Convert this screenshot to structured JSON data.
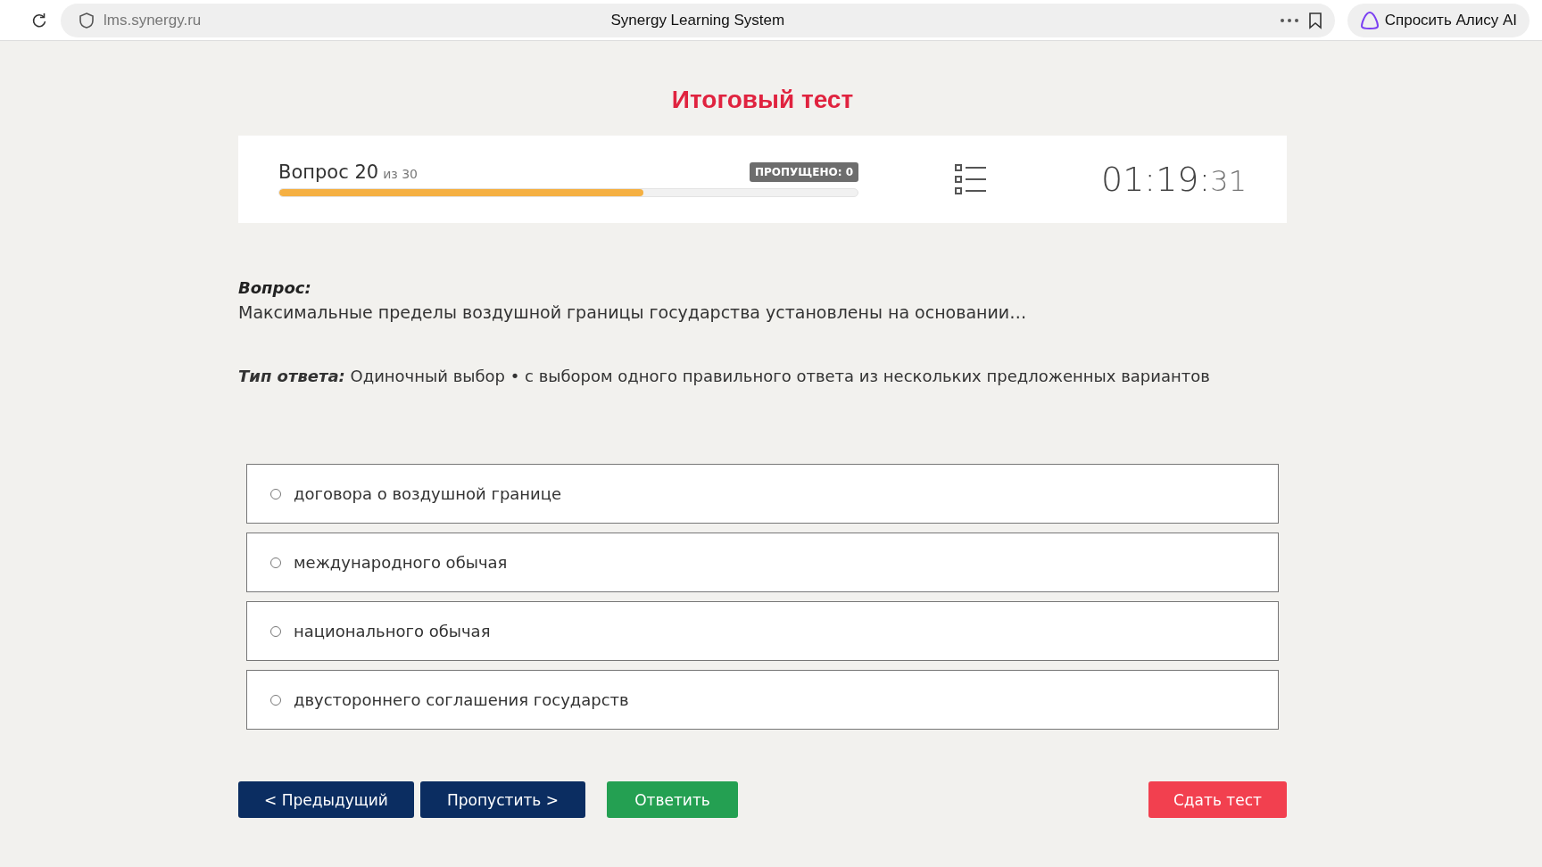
{
  "browser": {
    "address": "lms.synergy.ru",
    "title": "Synergy Learning System",
    "assistant_button": "Спросить Алису AI"
  },
  "page_title": "Итоговый тест",
  "progress": {
    "question_label": "Вопрос 20",
    "total_label": "из 30",
    "skipped_badge": "ПРОПУЩЕНО: 0",
    "level": 0.63,
    "timer_main": "01:19:",
    "timer_seconds": "31"
  },
  "question": {
    "label": "Вопрос:",
    "text": "Максимальные пределы воздушной границы государства установлены на основании…"
  },
  "answer_type": {
    "label": "Тип ответа:",
    "text": "Одиночный выбор • с выбором одного правильного ответа из нескольких предложенных вариантов"
  },
  "options": [
    {
      "text": "договора о воздушной границе",
      "selected": false
    },
    {
      "text": "международного обычая",
      "selected": false
    },
    {
      "text": "национального обычая",
      "selected": false
    },
    {
      "text": "двустороннего соглашения государств",
      "selected": false
    }
  ],
  "buttons": [
    {
      "label": "< Предыдущий",
      "kind": "nav"
    },
    {
      "label": "Пропустить >",
      "kind": "nav"
    },
    {
      "label": "Ответить",
      "kind": "answer"
    },
    {
      "label": "Сдать тест",
      "kind": "submit"
    }
  ]
}
